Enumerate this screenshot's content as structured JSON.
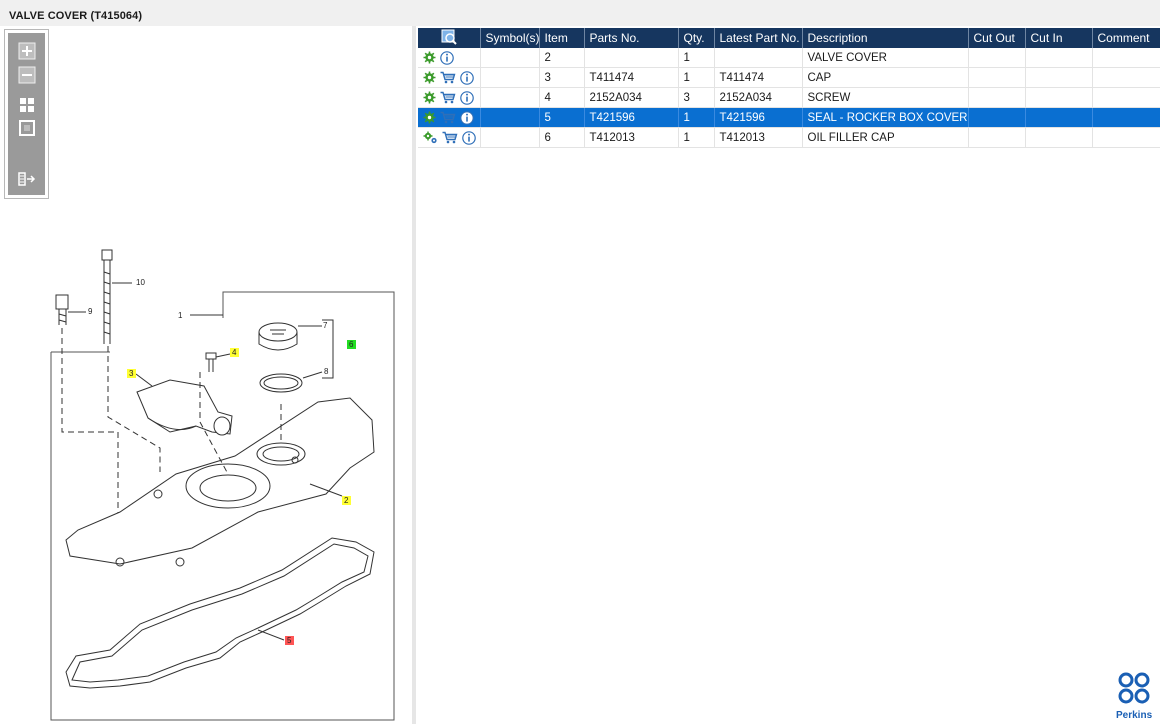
{
  "window": {
    "title": "VALVE COVER (T415064)"
  },
  "toolbar": {
    "items": [
      {
        "name": "zoom-in",
        "icon": "zoom-in-icon"
      },
      {
        "name": "zoom-out",
        "icon": "zoom-out-icon"
      },
      {
        "name": "fit-page",
        "icon": "fit-page-icon"
      },
      {
        "name": "actual-size",
        "icon": "actual-size-icon"
      },
      {
        "name": "hide-list",
        "icon": "panel-collapse-icon"
      }
    ]
  },
  "diagram": {
    "callouts": [
      "10",
      "9",
      "1",
      "7",
      "6",
      "8",
      "4",
      "3",
      "2",
      "5"
    ]
  },
  "table": {
    "header_icon": "find-in-diagram-icon",
    "columns": [
      "Symbol(s)",
      "Item",
      "Parts No.",
      "Qty.",
      "Latest Part No.",
      "Description",
      "Cut Out",
      "Cut In",
      "Comment"
    ],
    "rows": [
      {
        "icons": [
          "gear-icon",
          "info-icon"
        ],
        "symbols": "",
        "item": "2",
        "part_no": "",
        "qty": "1",
        "latest_part_no": "",
        "description": "VALVE COVER",
        "cut_out": "",
        "cut_in": "",
        "comment": "",
        "selected": false
      },
      {
        "icons": [
          "gear-icon",
          "cart-icon",
          "info-icon"
        ],
        "symbols": "",
        "item": "3",
        "part_no": "T411474",
        "qty": "1",
        "latest_part_no": "T411474",
        "description": "CAP",
        "cut_out": "",
        "cut_in": "",
        "comment": "",
        "selected": false
      },
      {
        "icons": [
          "gear-icon",
          "cart-icon",
          "info-icon"
        ],
        "symbols": "",
        "item": "4",
        "part_no": "2152A034",
        "qty": "3",
        "latest_part_no": "2152A034",
        "description": "SCREW",
        "cut_out": "",
        "cut_in": "",
        "comment": "",
        "selected": false
      },
      {
        "icons": [
          "gear-icon",
          "cart-icon",
          "info-icon"
        ],
        "symbols": "",
        "item": "5",
        "part_no": "T421596",
        "qty": "1",
        "latest_part_no": "T421596",
        "description": "SEAL - ROCKER BOX COVER",
        "cut_out": "",
        "cut_in": "",
        "comment": "",
        "selected": true
      },
      {
        "icons": [
          "gears-icon",
          "cart-icon",
          "info-icon"
        ],
        "symbols": "",
        "item": "6",
        "part_no": "T412013",
        "qty": "1",
        "latest_part_no": "T412013",
        "description": "OIL FILLER CAP",
        "cut_out": "",
        "cut_in": "",
        "comment": "",
        "selected": false
      }
    ]
  },
  "brand": {
    "name": "Perkins",
    "color": "#1a5fb4"
  },
  "colors": {
    "header_bg": "#16365f",
    "selected_row": "#0a6fd1",
    "highlight_yellow": "#ffff33",
    "highlight_green": "#22dd22",
    "highlight_red": "#ff5555"
  }
}
